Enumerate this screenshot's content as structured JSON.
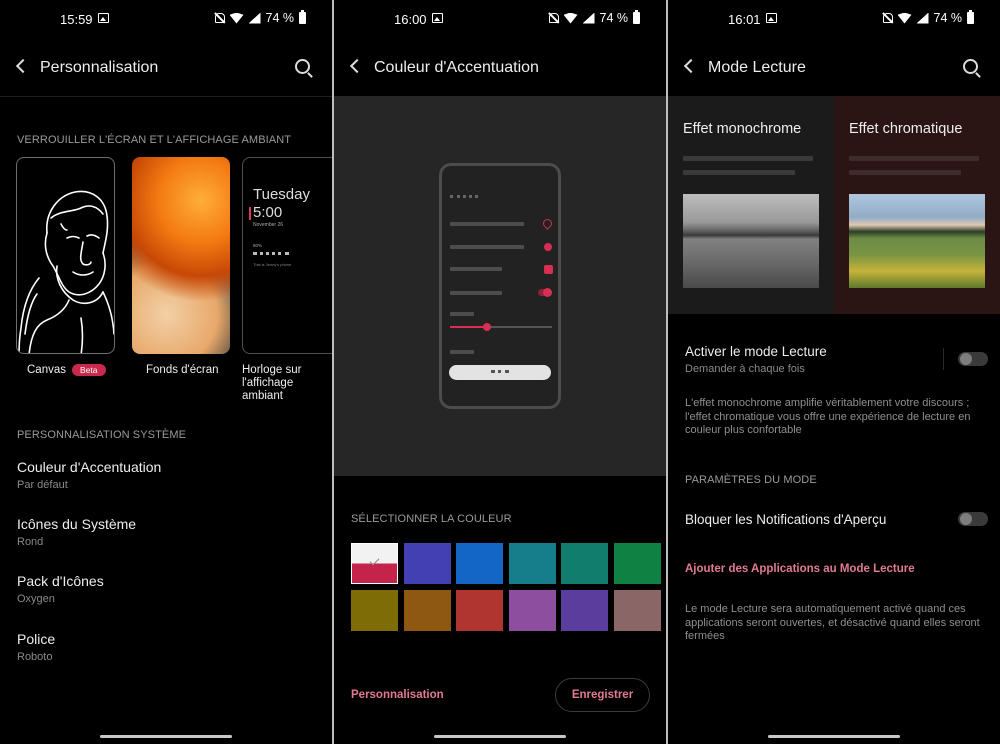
{
  "status": {
    "s1": {
      "time": "15:59",
      "battery": "74 %"
    },
    "s2": {
      "time": "16:00",
      "battery": "74 %"
    },
    "s3": {
      "time": "16:01",
      "battery": "74 %"
    }
  },
  "screen1": {
    "title": "Personnalisation",
    "section_lock": "VERROUILLER L'ÉCRAN ET L'AFFICHAGE AMBIANT",
    "thumbs": [
      {
        "label": "Canvas",
        "badge": "Beta"
      },
      {
        "label": "Fonds d'écran"
      },
      {
        "label": "Horloge sur l'affichage ambiant"
      }
    ],
    "clock": {
      "day": "Tuesday",
      "time": "5:00",
      "date": "November 26",
      "battery": "80%",
      "phone": "This is Jenny's phone"
    },
    "section_system": "PERSONNALISATION SYSTÈME",
    "items": [
      {
        "title": "Couleur d'Accentuation",
        "sub": "Par défaut"
      },
      {
        "title": "Icônes du Système",
        "sub": "Rond"
      },
      {
        "title": "Pack d'Icônes",
        "sub": "Oxygen"
      },
      {
        "title": "Police",
        "sub": "Roboto"
      }
    ]
  },
  "screen2": {
    "title": "Couleur d'Accentuation",
    "section": "SÉLECTIONNER LA COULEUR",
    "swatches": [
      "selected",
      "#4340b4",
      "#1466c6",
      "#157e8a",
      "#117d6c",
      "#0f8243",
      "#7e6c07",
      "#8f5812",
      "#b03531",
      "#8e4ea0",
      "#5b3d9e",
      "#8a6667"
    ],
    "accent": "#e27a94",
    "custom_link": "Personnalisation",
    "save_button": "Enregistrer"
  },
  "screen3": {
    "title": "Mode Lecture",
    "mono_title": "Effet monochrome",
    "chrom_title": "Effet chromatique",
    "enable_title": "Activer le mode Lecture",
    "enable_sub": "Demander à chaque fois",
    "enable_on": false,
    "description": "L'effet monochrome amplifie véritablement votre discours ; l'effet chromatique vous offre une expérience de lecture en couleur plus confortable",
    "section_params": "PARAMÈTRES DU MODE",
    "block_title": "Bloquer les Notifications d'Aperçu",
    "block_on": false,
    "add_apps": "Ajouter des Applications au Mode Lecture",
    "footer": "Le mode Lecture sera automatiquement activé quand ces applications seront ouvertes, et désactivé quand elles seront fermées"
  }
}
